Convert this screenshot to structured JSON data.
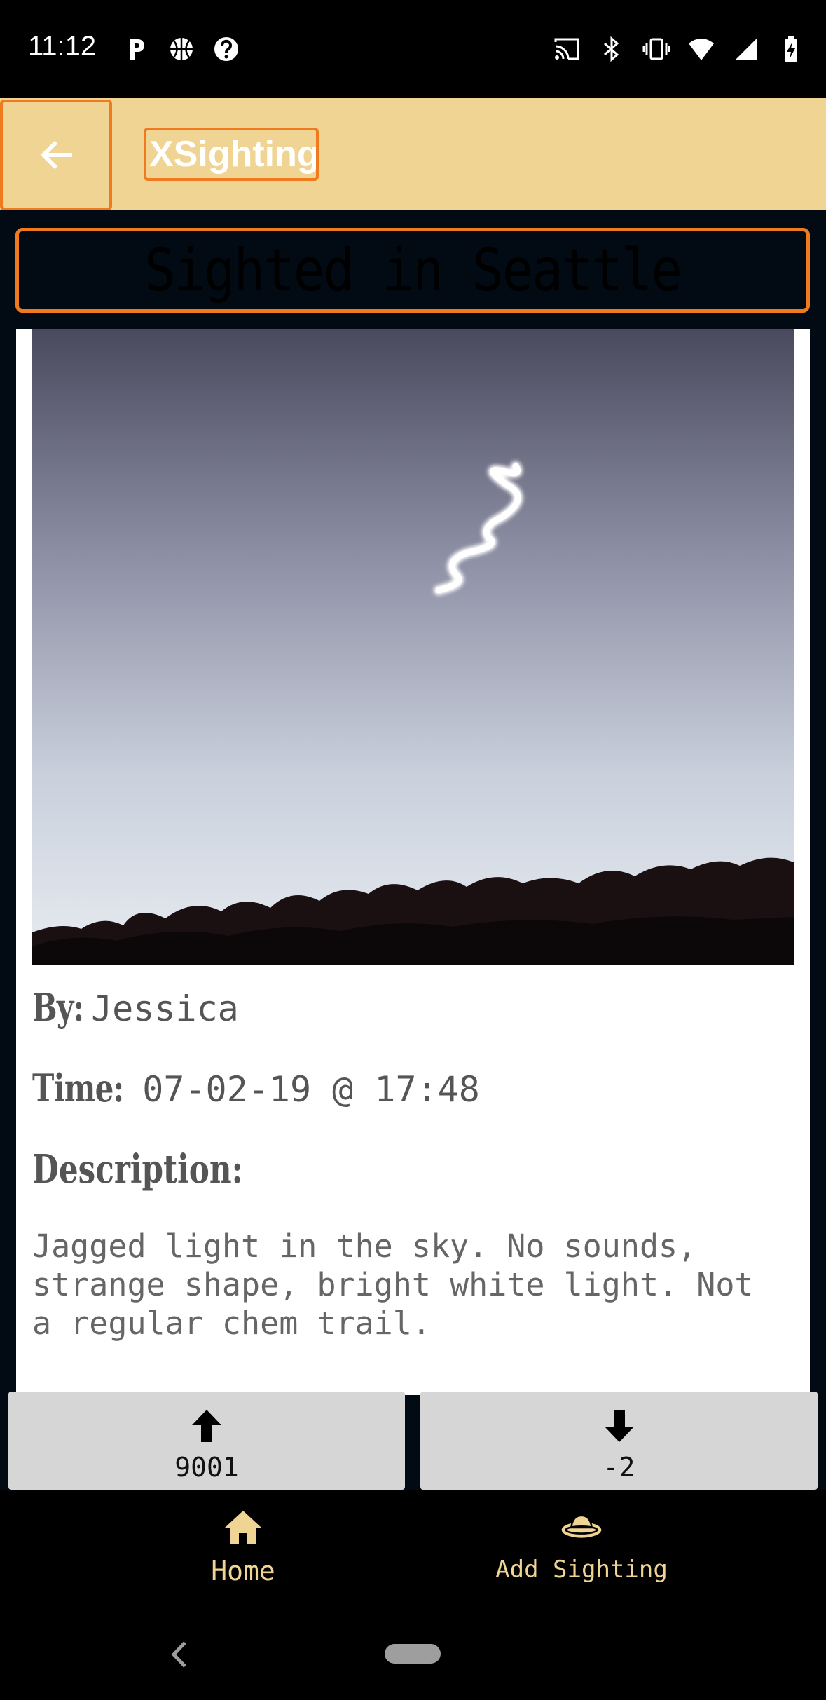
{
  "status_bar": {
    "time": "11:12",
    "left_icons": [
      "parking-icon",
      "basketball-icon",
      "help-icon"
    ],
    "right_icons": [
      "cast-icon",
      "bluetooth-icon",
      "vibrate-icon",
      "wifi-icon",
      "signal-icon",
      "battery-charging-icon"
    ]
  },
  "app_bar": {
    "back_icon": "arrow-left-icon",
    "title": "XSighting"
  },
  "sighting": {
    "title": "Sighted in Seattle",
    "by_label": "By:",
    "by_value": "Jessica",
    "time_label": "Time:",
    "time_value": "07-02-19 @ 17:48",
    "description_label": "Description:",
    "description": "Jagged light in the sky. No sounds, strange shape, bright white light. Not a regular chem trail."
  },
  "votes": {
    "up_icon": "arrow-up-icon",
    "up_count": "9001",
    "down_icon": "arrow-down-icon",
    "down_count": "-2"
  },
  "bottom_nav": {
    "items": [
      {
        "label": "Home",
        "icon": "home-icon"
      },
      {
        "label": "Add Sighting",
        "icon": "ufo-icon"
      }
    ]
  },
  "colors": {
    "app_bar": "#efd494",
    "highlight": "#f07a1e",
    "nav_label": "#efd494",
    "vote_button": "#d6d6d6"
  }
}
